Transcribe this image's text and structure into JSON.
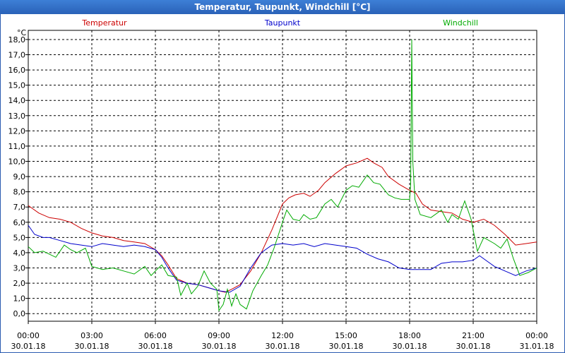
{
  "window": {
    "title": "Temperatur, Taupunkt, Windchill [°C]"
  },
  "colors": {
    "titlebar": "#2a62b8",
    "temperatur": "#cc0000",
    "taupunkt": "#0000cc",
    "windchill": "#00aa00",
    "grid": "#000000"
  },
  "chart_data": {
    "type": "line",
    "title": "Temperatur, Taupunkt, Windchill [°C]",
    "ylabel": "°C",
    "ylim": [
      -0.5,
      18.6
    ],
    "xlim": [
      0,
      24
    ],
    "grid": true,
    "legend_placement": "top",
    "y_ticks": [
      "0,0",
      "1,0",
      "2,0",
      "3,0",
      "4,0",
      "5,0",
      "6,0",
      "7,0",
      "8,0",
      "9,0",
      "10,0",
      "11,0",
      "12,0",
      "13,0",
      "14,0",
      "15,0",
      "16,0",
      "17,0",
      "18,0"
    ],
    "x_ticks": [
      {
        "time": "00:00",
        "date": "30.01.18"
      },
      {
        "time": "03:00",
        "date": "30.01.18"
      },
      {
        "time": "06:00",
        "date": "30.01.18"
      },
      {
        "time": "09:00",
        "date": "30.01.18"
      },
      {
        "time": "12:00",
        "date": "30.01.18"
      },
      {
        "time": "15:00",
        "date": "30.01.18"
      },
      {
        "time": "18:00",
        "date": "30.01.18"
      },
      {
        "time": "21:00",
        "date": "30.01.18"
      },
      {
        "time": "00:00",
        "date": "31.01.18"
      }
    ],
    "series": [
      {
        "name": "Temperatur",
        "color": "#cc0000",
        "points": [
          [
            0,
            7.1
          ],
          [
            0.5,
            6.6
          ],
          [
            1,
            6.3
          ],
          [
            1.5,
            6.2
          ],
          [
            2,
            6.0
          ],
          [
            2.5,
            5.6
          ],
          [
            3,
            5.3
          ],
          [
            3.5,
            5.1
          ],
          [
            4,
            5.0
          ],
          [
            4.5,
            4.8
          ],
          [
            5,
            4.7
          ],
          [
            5.5,
            4.6
          ],
          [
            6,
            4.2
          ],
          [
            6.3,
            3.8
          ],
          [
            6.6,
            3.2
          ],
          [
            7,
            2.3
          ],
          [
            7.5,
            2.0
          ],
          [
            8,
            1.9
          ],
          [
            8.5,
            1.7
          ],
          [
            9,
            1.5
          ],
          [
            9.3,
            1.4
          ],
          [
            9.6,
            1.6
          ],
          [
            10,
            1.9
          ],
          [
            10.5,
            2.8
          ],
          [
            11,
            4.0
          ],
          [
            11.5,
            5.5
          ],
          [
            12,
            7.2
          ],
          [
            12.3,
            7.6
          ],
          [
            12.6,
            7.8
          ],
          [
            13,
            7.9
          ],
          [
            13.3,
            7.7
          ],
          [
            13.7,
            8.1
          ],
          [
            14,
            8.6
          ],
          [
            14.5,
            9.2
          ],
          [
            15,
            9.7
          ],
          [
            15.5,
            9.9
          ],
          [
            16,
            10.2
          ],
          [
            16.3,
            9.9
          ],
          [
            16.7,
            9.6
          ],
          [
            17,
            9.0
          ],
          [
            17.5,
            8.5
          ],
          [
            18,
            8.1
          ],
          [
            18.3,
            7.9
          ],
          [
            18.6,
            7.2
          ],
          [
            19,
            6.8
          ],
          [
            19.5,
            6.7
          ],
          [
            20,
            6.6
          ],
          [
            20.5,
            6.2
          ],
          [
            21,
            6.0
          ],
          [
            21.5,
            6.2
          ],
          [
            22,
            5.8
          ],
          [
            22.5,
            5.2
          ],
          [
            23,
            4.5
          ],
          [
            23.5,
            4.6
          ],
          [
            24,
            4.7
          ]
        ]
      },
      {
        "name": "Taupunkt",
        "color": "#0000cc",
        "points": [
          [
            0,
            5.8
          ],
          [
            0.3,
            5.2
          ],
          [
            0.7,
            5.0
          ],
          [
            1,
            5.0
          ],
          [
            1.5,
            4.8
          ],
          [
            2,
            4.6
          ],
          [
            2.5,
            4.5
          ],
          [
            3,
            4.4
          ],
          [
            3.5,
            4.6
          ],
          [
            4,
            4.5
          ],
          [
            4.5,
            4.4
          ],
          [
            5,
            4.5
          ],
          [
            5.5,
            4.4
          ],
          [
            6,
            4.2
          ],
          [
            6.3,
            3.7
          ],
          [
            6.6,
            3.0
          ],
          [
            7,
            2.2
          ],
          [
            7.5,
            2.0
          ],
          [
            8,
            1.9
          ],
          [
            8.5,
            1.7
          ],
          [
            9,
            1.5
          ],
          [
            9.5,
            1.4
          ],
          [
            10,
            1.8
          ],
          [
            10.5,
            3.0
          ],
          [
            11,
            4.0
          ],
          [
            11.5,
            4.5
          ],
          [
            12,
            4.6
          ],
          [
            12.5,
            4.5
          ],
          [
            13,
            4.6
          ],
          [
            13.5,
            4.4
          ],
          [
            14,
            4.6
          ],
          [
            14.5,
            4.5
          ],
          [
            15,
            4.4
          ],
          [
            15.5,
            4.3
          ],
          [
            16,
            3.9
          ],
          [
            16.5,
            3.6
          ],
          [
            17,
            3.4
          ],
          [
            17.5,
            3.0
          ],
          [
            18,
            2.9
          ],
          [
            18.5,
            2.9
          ],
          [
            19,
            2.9
          ],
          [
            19.5,
            3.3
          ],
          [
            20,
            3.4
          ],
          [
            20.5,
            3.4
          ],
          [
            21,
            3.5
          ],
          [
            21.3,
            3.8
          ],
          [
            21.7,
            3.4
          ],
          [
            22,
            3.1
          ],
          [
            22.5,
            2.8
          ],
          [
            23,
            2.5
          ],
          [
            23.5,
            2.8
          ],
          [
            24,
            3.0
          ]
        ]
      },
      {
        "name": "Windchill",
        "color": "#00aa00",
        "points": [
          [
            0,
            4.4
          ],
          [
            0.3,
            4.0
          ],
          [
            0.7,
            4.1
          ],
          [
            1,
            3.9
          ],
          [
            1.3,
            3.7
          ],
          [
            1.7,
            4.5
          ],
          [
            2,
            4.2
          ],
          [
            2.3,
            4.0
          ],
          [
            2.7,
            4.3
          ],
          [
            3,
            3.1
          ],
          [
            3.5,
            2.9
          ],
          [
            4,
            3.0
          ],
          [
            4.5,
            2.8
          ],
          [
            5,
            2.6
          ],
          [
            5.5,
            3.1
          ],
          [
            5.8,
            2.5
          ],
          [
            6,
            2.8
          ],
          [
            6.3,
            3.2
          ],
          [
            6.6,
            2.5
          ],
          [
            7,
            2.4
          ],
          [
            7.2,
            1.2
          ],
          [
            7.5,
            2.0
          ],
          [
            7.7,
            1.3
          ],
          [
            8,
            1.8
          ],
          [
            8.3,
            2.8
          ],
          [
            8.6,
            2.0
          ],
          [
            8.9,
            1.6
          ],
          [
            9.0,
            0.2
          ],
          [
            9.2,
            0.6
          ],
          [
            9.4,
            1.6
          ],
          [
            9.6,
            0.5
          ],
          [
            9.8,
            1.3
          ],
          [
            10,
            0.6
          ],
          [
            10.3,
            0.3
          ],
          [
            10.6,
            1.5
          ],
          [
            11,
            2.5
          ],
          [
            11.3,
            3.2
          ],
          [
            11.6,
            4.3
          ],
          [
            12,
            6.0
          ],
          [
            12.2,
            6.8
          ],
          [
            12.5,
            6.2
          ],
          [
            12.8,
            6.1
          ],
          [
            13,
            6.5
          ],
          [
            13.3,
            6.2
          ],
          [
            13.6,
            6.3
          ],
          [
            14,
            7.2
          ],
          [
            14.3,
            7.5
          ],
          [
            14.6,
            7.0
          ],
          [
            15,
            8.1
          ],
          [
            15.3,
            8.4
          ],
          [
            15.6,
            8.3
          ],
          [
            16,
            9.1
          ],
          [
            16.3,
            8.6
          ],
          [
            16.6,
            8.5
          ],
          [
            17,
            7.8
          ],
          [
            17.3,
            7.6
          ],
          [
            17.6,
            7.5
          ],
          [
            18,
            7.5
          ],
          [
            18.05,
            8.5
          ],
          [
            18.1,
            18.0
          ],
          [
            18.15,
            10.0
          ],
          [
            18.25,
            7.5
          ],
          [
            18.5,
            6.5
          ],
          [
            19,
            6.3
          ],
          [
            19.5,
            6.8
          ],
          [
            19.8,
            6.0
          ],
          [
            20,
            6.5
          ],
          [
            20.3,
            6.2
          ],
          [
            20.6,
            7.4
          ],
          [
            20.9,
            6.2
          ],
          [
            21.2,
            4.1
          ],
          [
            21.5,
            5.0
          ],
          [
            22,
            4.6
          ],
          [
            22.3,
            4.3
          ],
          [
            22.6,
            4.9
          ],
          [
            22.9,
            3.6
          ],
          [
            23.2,
            2.5
          ],
          [
            23.6,
            2.7
          ],
          [
            24,
            3.0
          ]
        ]
      }
    ]
  }
}
